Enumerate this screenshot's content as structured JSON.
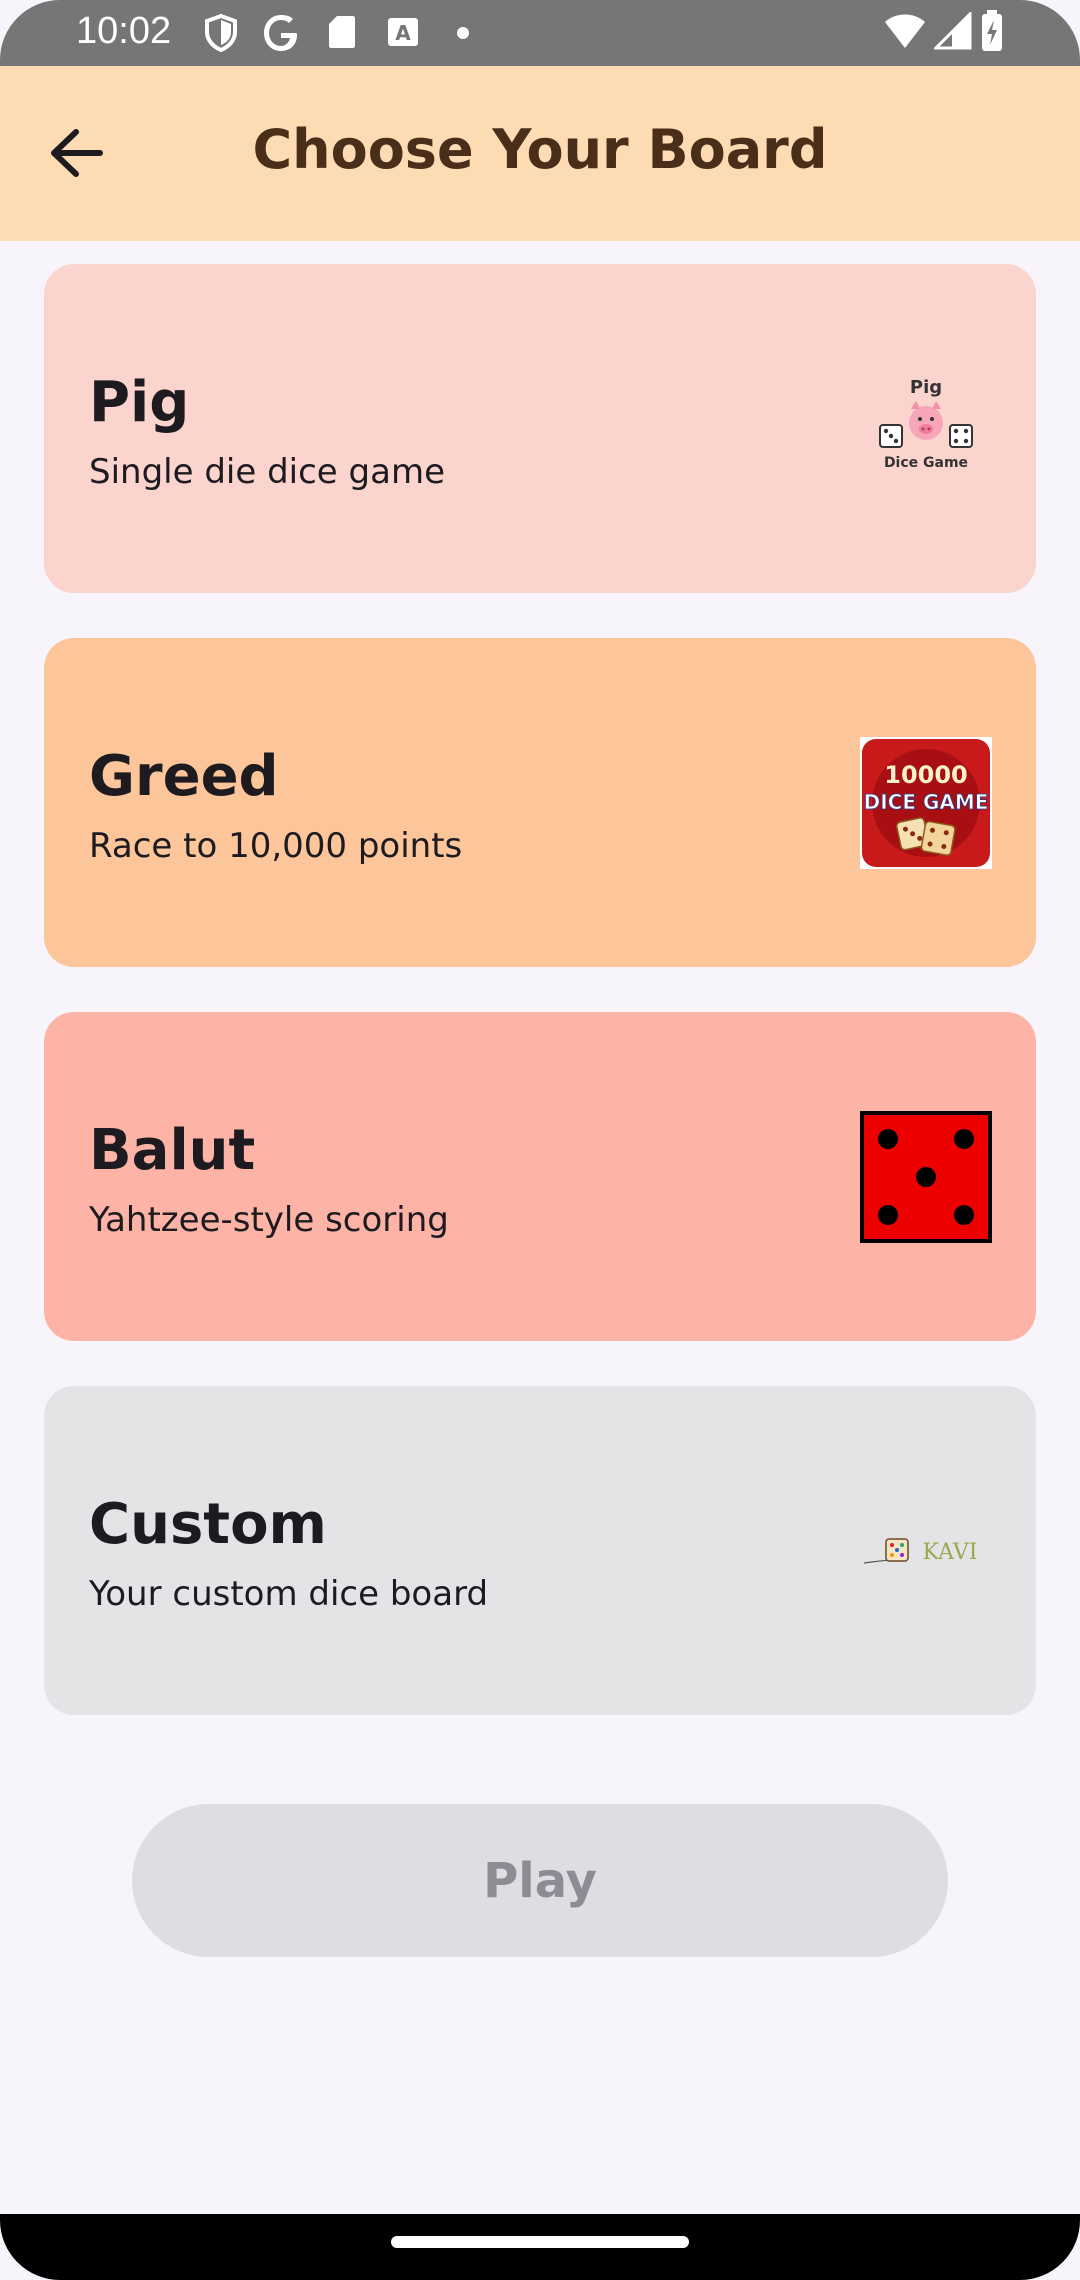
{
  "status_bar": {
    "time": "10:02",
    "left_icons": [
      "shield-icon",
      "google-icon",
      "sd-card-icon",
      "text-a-icon",
      "dot-icon"
    ],
    "right_icons": [
      "wifi-icon",
      "signal-icon",
      "battery-charging-icon"
    ]
  },
  "app_bar": {
    "title": "Choose Your Board",
    "back_icon": "arrow-back-icon"
  },
  "boards": [
    {
      "title": "Pig",
      "subtitle": "Single die dice game",
      "color": "#fbd4cd",
      "thumb": {
        "icon": "pig-dice-logo",
        "top_label": "Pig",
        "bottom_label": "Dice Game"
      }
    },
    {
      "title": "Greed",
      "subtitle": "Race to 10,000 points",
      "color": "#fcc69a",
      "thumb": {
        "icon": "dice-game-logo",
        "line1": "10000",
        "line2": "DICE GAME"
      }
    },
    {
      "title": "Balut",
      "subtitle": "Yahtzee-style scoring",
      "color": "#fdb3a6",
      "thumb": {
        "icon": "red-die-five-icon"
      }
    },
    {
      "title": "Custom",
      "subtitle": "Your custom dice board",
      "color": "#e4e3e5",
      "thumb": {
        "icon": "kavi-dice-logo",
        "label": "KAVI"
      }
    }
  ],
  "play_button": {
    "label": "Play",
    "enabled": false
  }
}
